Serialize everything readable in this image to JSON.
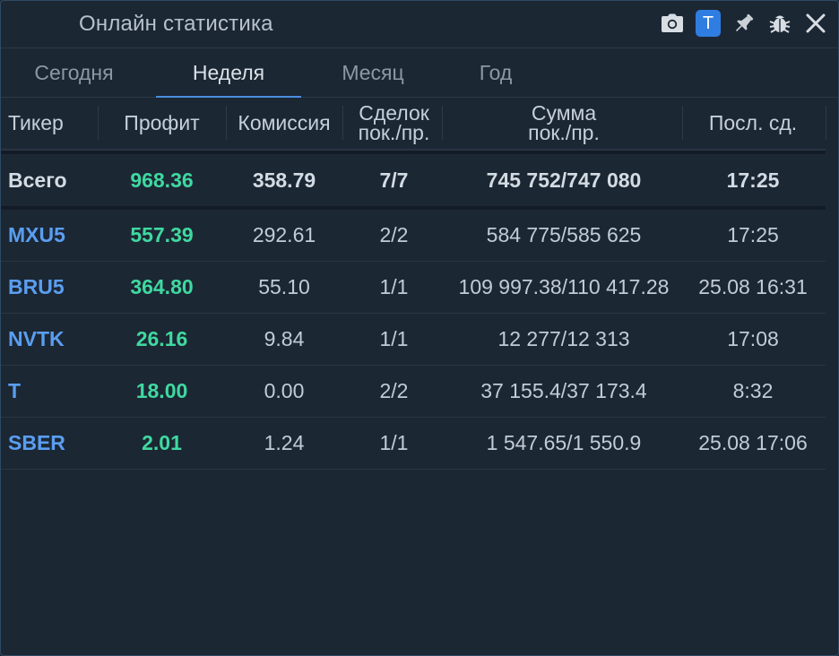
{
  "window": {
    "title": "Онлайн статистика"
  },
  "title_icons": [
    {
      "name": "camera-icon"
    },
    {
      "name": "t-badge",
      "label": "T"
    },
    {
      "name": "pin-icon"
    },
    {
      "name": "bug-icon"
    },
    {
      "name": "close-icon"
    }
  ],
  "tabs": [
    {
      "label": "Сегодня"
    },
    {
      "label": "Неделя"
    },
    {
      "label": "Месяц"
    },
    {
      "label": "Год"
    }
  ],
  "active_tab": "Неделя",
  "table": {
    "headers": {
      "ticker": "Тикер",
      "profit": "Профит",
      "commission": "Комиссия",
      "deals_line1": "Сделок",
      "deals_line2": "пок./пр.",
      "sum_line1": "Сумма",
      "sum_line2": "пок./пр.",
      "last": "Посл. сд."
    },
    "total": {
      "ticker": "Всего",
      "profit": "968.36",
      "commission": "358.79",
      "deals": "7/7",
      "sum": "745 752/747 080",
      "last": "17:25"
    },
    "rows": [
      {
        "ticker": "MXU5",
        "profit": "557.39",
        "commission": "292.61",
        "deals": "2/2",
        "sum": "584 775/585 625",
        "last": "17:25"
      },
      {
        "ticker": "BRU5",
        "profit": "364.80",
        "commission": "55.10",
        "deals": "1/1",
        "sum": "109 997.38/110 417.28",
        "last": "25.08 16:31"
      },
      {
        "ticker": "NVTK",
        "profit": "26.16",
        "commission": "9.84",
        "deals": "1/1",
        "sum": "12 277/12 313",
        "last": "17:08"
      },
      {
        "ticker": "T",
        "profit": "18.00",
        "commission": "0.00",
        "deals": "2/2",
        "sum": "37 155.4/37 173.4",
        "last": "8:32"
      },
      {
        "ticker": "SBER",
        "profit": "2.01",
        "commission": "1.24",
        "deals": "1/1",
        "sum": "1 547.65/1 550.9",
        "last": "25.08 17:06"
      }
    ]
  },
  "colors": {
    "background": "#1c2734",
    "accent": "#2f7de1",
    "profit": "#3fd9a0",
    "ticker": "#5a9ef0"
  }
}
